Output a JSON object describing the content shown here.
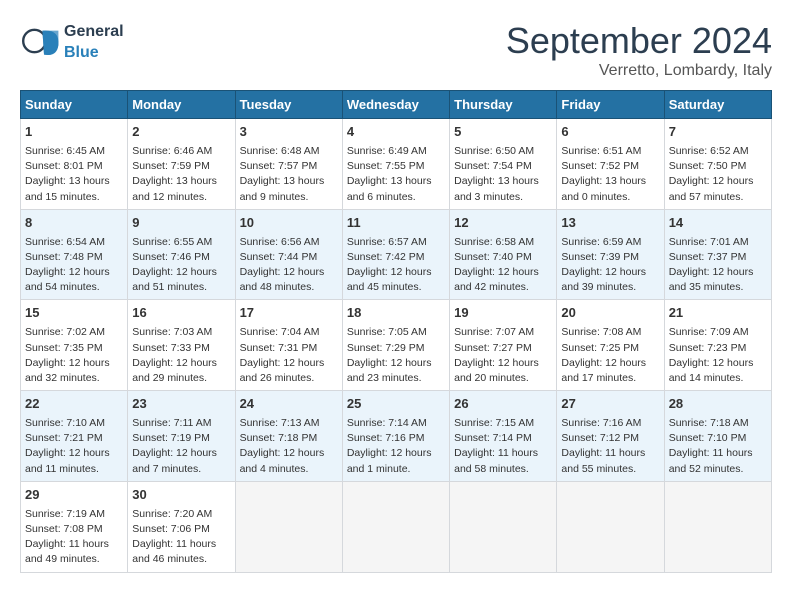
{
  "header": {
    "logo_general": "General",
    "logo_blue": "Blue",
    "title": "September 2024",
    "subtitle": "Verretto, Lombardy, Italy"
  },
  "weekdays": [
    "Sunday",
    "Monday",
    "Tuesday",
    "Wednesday",
    "Thursday",
    "Friday",
    "Saturday"
  ],
  "weeks": [
    [
      {
        "day": "1",
        "lines": [
          "Sunrise: 6:45 AM",
          "Sunset: 8:01 PM",
          "Daylight: 13 hours",
          "and 15 minutes."
        ]
      },
      {
        "day": "2",
        "lines": [
          "Sunrise: 6:46 AM",
          "Sunset: 7:59 PM",
          "Daylight: 13 hours",
          "and 12 minutes."
        ]
      },
      {
        "day": "3",
        "lines": [
          "Sunrise: 6:48 AM",
          "Sunset: 7:57 PM",
          "Daylight: 13 hours",
          "and 9 minutes."
        ]
      },
      {
        "day": "4",
        "lines": [
          "Sunrise: 6:49 AM",
          "Sunset: 7:55 PM",
          "Daylight: 13 hours",
          "and 6 minutes."
        ]
      },
      {
        "day": "5",
        "lines": [
          "Sunrise: 6:50 AM",
          "Sunset: 7:54 PM",
          "Daylight: 13 hours",
          "and 3 minutes."
        ]
      },
      {
        "day": "6",
        "lines": [
          "Sunrise: 6:51 AM",
          "Sunset: 7:52 PM",
          "Daylight: 13 hours",
          "and 0 minutes."
        ]
      },
      {
        "day": "7",
        "lines": [
          "Sunrise: 6:52 AM",
          "Sunset: 7:50 PM",
          "Daylight: 12 hours",
          "and 57 minutes."
        ]
      }
    ],
    [
      {
        "day": "8",
        "lines": [
          "Sunrise: 6:54 AM",
          "Sunset: 7:48 PM",
          "Daylight: 12 hours",
          "and 54 minutes."
        ]
      },
      {
        "day": "9",
        "lines": [
          "Sunrise: 6:55 AM",
          "Sunset: 7:46 PM",
          "Daylight: 12 hours",
          "and 51 minutes."
        ]
      },
      {
        "day": "10",
        "lines": [
          "Sunrise: 6:56 AM",
          "Sunset: 7:44 PM",
          "Daylight: 12 hours",
          "and 48 minutes."
        ]
      },
      {
        "day": "11",
        "lines": [
          "Sunrise: 6:57 AM",
          "Sunset: 7:42 PM",
          "Daylight: 12 hours",
          "and 45 minutes."
        ]
      },
      {
        "day": "12",
        "lines": [
          "Sunrise: 6:58 AM",
          "Sunset: 7:40 PM",
          "Daylight: 12 hours",
          "and 42 minutes."
        ]
      },
      {
        "day": "13",
        "lines": [
          "Sunrise: 6:59 AM",
          "Sunset: 7:39 PM",
          "Daylight: 12 hours",
          "and 39 minutes."
        ]
      },
      {
        "day": "14",
        "lines": [
          "Sunrise: 7:01 AM",
          "Sunset: 7:37 PM",
          "Daylight: 12 hours",
          "and 35 minutes."
        ]
      }
    ],
    [
      {
        "day": "15",
        "lines": [
          "Sunrise: 7:02 AM",
          "Sunset: 7:35 PM",
          "Daylight: 12 hours",
          "and 32 minutes."
        ]
      },
      {
        "day": "16",
        "lines": [
          "Sunrise: 7:03 AM",
          "Sunset: 7:33 PM",
          "Daylight: 12 hours",
          "and 29 minutes."
        ]
      },
      {
        "day": "17",
        "lines": [
          "Sunrise: 7:04 AM",
          "Sunset: 7:31 PM",
          "Daylight: 12 hours",
          "and 26 minutes."
        ]
      },
      {
        "day": "18",
        "lines": [
          "Sunrise: 7:05 AM",
          "Sunset: 7:29 PM",
          "Daylight: 12 hours",
          "and 23 minutes."
        ]
      },
      {
        "day": "19",
        "lines": [
          "Sunrise: 7:07 AM",
          "Sunset: 7:27 PM",
          "Daylight: 12 hours",
          "and 20 minutes."
        ]
      },
      {
        "day": "20",
        "lines": [
          "Sunrise: 7:08 AM",
          "Sunset: 7:25 PM",
          "Daylight: 12 hours",
          "and 17 minutes."
        ]
      },
      {
        "day": "21",
        "lines": [
          "Sunrise: 7:09 AM",
          "Sunset: 7:23 PM",
          "Daylight: 12 hours",
          "and 14 minutes."
        ]
      }
    ],
    [
      {
        "day": "22",
        "lines": [
          "Sunrise: 7:10 AM",
          "Sunset: 7:21 PM",
          "Daylight: 12 hours",
          "and 11 minutes."
        ]
      },
      {
        "day": "23",
        "lines": [
          "Sunrise: 7:11 AM",
          "Sunset: 7:19 PM",
          "Daylight: 12 hours",
          "and 7 minutes."
        ]
      },
      {
        "day": "24",
        "lines": [
          "Sunrise: 7:13 AM",
          "Sunset: 7:18 PM",
          "Daylight: 12 hours",
          "and 4 minutes."
        ]
      },
      {
        "day": "25",
        "lines": [
          "Sunrise: 7:14 AM",
          "Sunset: 7:16 PM",
          "Daylight: 12 hours",
          "and 1 minute."
        ]
      },
      {
        "day": "26",
        "lines": [
          "Sunrise: 7:15 AM",
          "Sunset: 7:14 PM",
          "Daylight: 11 hours",
          "and 58 minutes."
        ]
      },
      {
        "day": "27",
        "lines": [
          "Sunrise: 7:16 AM",
          "Sunset: 7:12 PM",
          "Daylight: 11 hours",
          "and 55 minutes."
        ]
      },
      {
        "day": "28",
        "lines": [
          "Sunrise: 7:18 AM",
          "Sunset: 7:10 PM",
          "Daylight: 11 hours",
          "and 52 minutes."
        ]
      }
    ],
    [
      {
        "day": "29",
        "lines": [
          "Sunrise: 7:19 AM",
          "Sunset: 7:08 PM",
          "Daylight: 11 hours",
          "and 49 minutes."
        ]
      },
      {
        "day": "30",
        "lines": [
          "Sunrise: 7:20 AM",
          "Sunset: 7:06 PM",
          "Daylight: 11 hours",
          "and 46 minutes."
        ]
      },
      {
        "day": "",
        "lines": []
      },
      {
        "day": "",
        "lines": []
      },
      {
        "day": "",
        "lines": []
      },
      {
        "day": "",
        "lines": []
      },
      {
        "day": "",
        "lines": []
      }
    ]
  ]
}
